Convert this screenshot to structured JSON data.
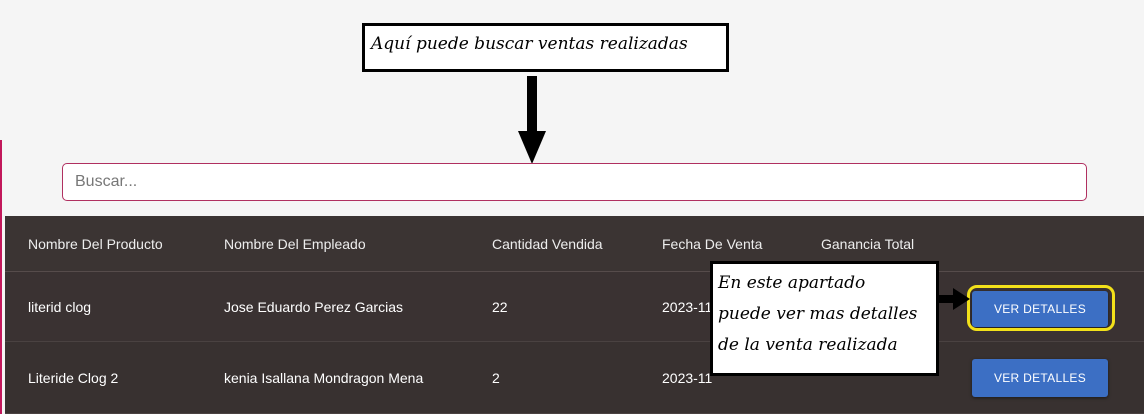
{
  "annotations": {
    "search_hint": "Aquí puede buscar ventas realizadas",
    "details_hint_lines": [
      "En este apartado",
      "puede ver mas detalles",
      "de la venta realizada"
    ]
  },
  "search": {
    "placeholder": "Buscar..."
  },
  "table": {
    "headers": [
      "Nombre Del Producto",
      "Nombre Del Empleado",
      "Cantidad Vendida",
      "Fecha De Venta",
      "Ganancia Total"
    ],
    "rows": [
      {
        "producto": "literid clog",
        "empleado": "Jose Eduardo Perez Garcias",
        "cantidad": "22",
        "fecha": "2023-11",
        "action": "VER DETALLES"
      },
      {
        "producto": "Literide Clog 2",
        "empleado": "kenia Isallana Mondragon Mena",
        "cantidad": "2",
        "fecha": "2023-11",
        "action": "VER DETALLES"
      }
    ]
  },
  "colors": {
    "accent": "#c2185b",
    "button": "#3c6fc4",
    "table_bg": "#3a3232",
    "highlight": "#f2e11a"
  }
}
